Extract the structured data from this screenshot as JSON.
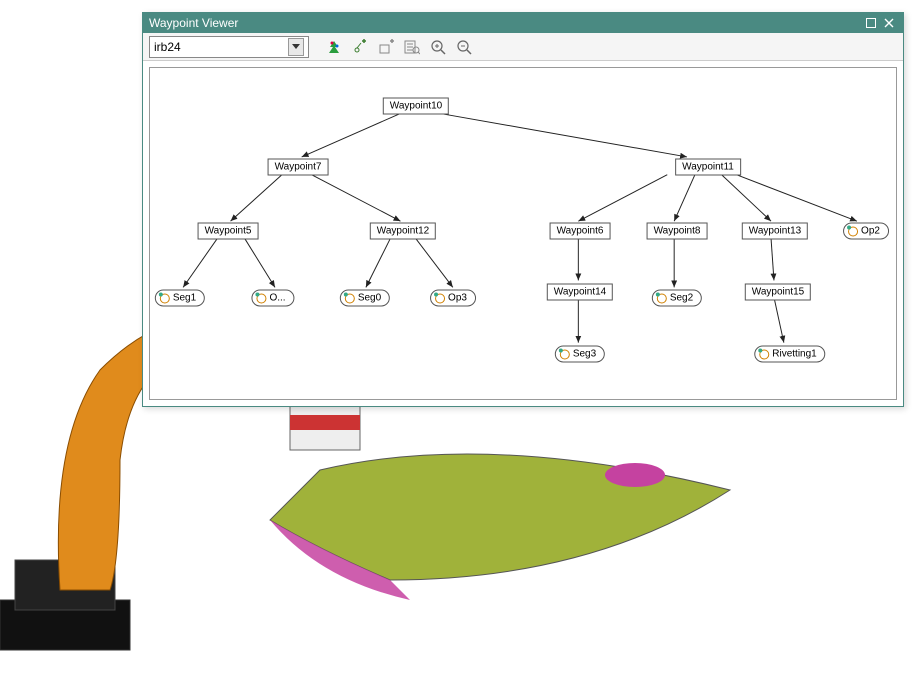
{
  "window": {
    "title": "Waypoint Viewer"
  },
  "toolbar": {
    "dropdown_value": "irb24"
  },
  "tree": {
    "root": "Waypoint10",
    "left": {
      "n": "Waypoint7",
      "l": {
        "n": "Waypoint5",
        "leaves": [
          "Seg1",
          "O..."
        ]
      },
      "r": {
        "n": "Waypoint12",
        "leaves": [
          "Seg0",
          "Op3"
        ]
      }
    },
    "right": {
      "n": "Waypoint11",
      "c1": {
        "n": "Waypoint6",
        "child": {
          "n": "Waypoint14",
          "leaf": "Seg3"
        }
      },
      "c2": {
        "n": "Waypoint8",
        "leaf": "Seg2"
      },
      "c3": {
        "n": "Waypoint13",
        "child": {
          "n": "Waypoint15",
          "leaf": "Rivetting1"
        }
      },
      "c4_leaf": "Op2"
    }
  }
}
